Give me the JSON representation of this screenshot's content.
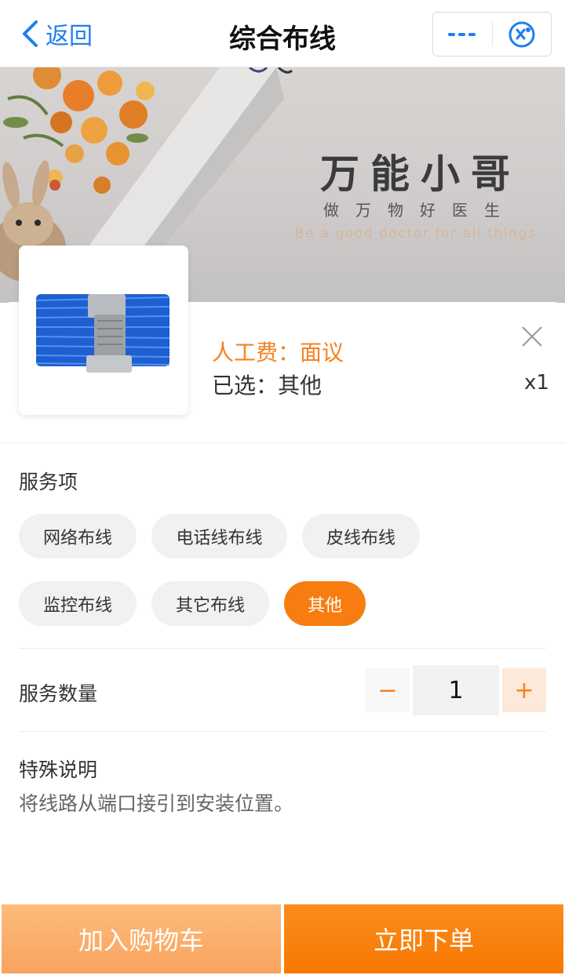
{
  "nav": {
    "back_label": "返回",
    "title": "综合布线"
  },
  "banner": {
    "brand_title": "万能小哥",
    "brand_subtitle": "做万物好医生",
    "brand_english": "Be a good doctor for all things"
  },
  "product": {
    "price_label": "人工费：面议",
    "selected_label": "已选：其他",
    "quantity_mark": "x1"
  },
  "service": {
    "label": "服务项",
    "options": [
      "网络布线",
      "电话线布线",
      "皮线布线",
      "监控布线",
      "其它布线",
      "其他"
    ],
    "selected": "其他"
  },
  "quantity": {
    "label": "服务数量",
    "minus": "−",
    "value": "1",
    "plus": "+"
  },
  "note": {
    "label": "特殊说明",
    "text": "将线路从端口接引到安装位置。"
  },
  "actions": {
    "add_to_cart": "加入购物车",
    "order_now": "立即下单"
  },
  "colors": {
    "accent": "#f87d10",
    "link_blue": "#1e7ef0",
    "cart_button": "#f9a35e",
    "order_button": "#f87800"
  },
  "icons": [
    "chevron-left-icon",
    "more-dots-icon",
    "close-miniprogram-icon",
    "close-icon"
  ]
}
